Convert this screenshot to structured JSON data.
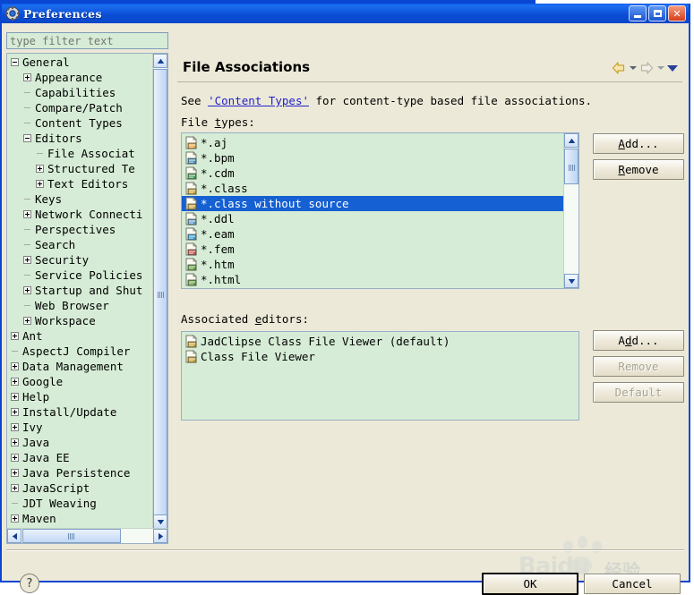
{
  "window": {
    "title": "Preferences",
    "icon": "preferences-gear-icon",
    "minimize_label": "Minimize",
    "maximize_label": "Maximize",
    "close_label": "Close",
    "title_bar_color": "#0a4fd6"
  },
  "sidebar": {
    "filter": {
      "placeholder": "type filter text",
      "value": ""
    },
    "items": [
      {
        "label": "General",
        "indent": 0,
        "toggle": "minus"
      },
      {
        "label": "Appearance",
        "indent": 1,
        "toggle": "plus"
      },
      {
        "label": "Capabilities",
        "indent": 1,
        "toggle": "dash"
      },
      {
        "label": "Compare/Patch",
        "indent": 1,
        "toggle": "dash"
      },
      {
        "label": "Content Types",
        "indent": 1,
        "toggle": "dash"
      },
      {
        "label": "Editors",
        "indent": 1,
        "toggle": "minus"
      },
      {
        "label": "File Associat",
        "indent": 2,
        "toggle": "dash",
        "selected_page": true
      },
      {
        "label": "Structured Te",
        "indent": 2,
        "toggle": "plus"
      },
      {
        "label": "Text Editors",
        "indent": 2,
        "toggle": "plus"
      },
      {
        "label": "Keys",
        "indent": 1,
        "toggle": "dash"
      },
      {
        "label": "Network Connecti",
        "indent": 1,
        "toggle": "plus"
      },
      {
        "label": "Perspectives",
        "indent": 1,
        "toggle": "dash"
      },
      {
        "label": "Search",
        "indent": 1,
        "toggle": "dash"
      },
      {
        "label": "Security",
        "indent": 1,
        "toggle": "plus"
      },
      {
        "label": "Service Policies",
        "indent": 1,
        "toggle": "dash"
      },
      {
        "label": "Startup and Shut",
        "indent": 1,
        "toggle": "plus"
      },
      {
        "label": "Web Browser",
        "indent": 1,
        "toggle": "dash"
      },
      {
        "label": "Workspace",
        "indent": 1,
        "toggle": "plus"
      },
      {
        "label": "Ant",
        "indent": 0,
        "toggle": "plus"
      },
      {
        "label": "AspectJ Compiler",
        "indent": 0,
        "toggle": "dash"
      },
      {
        "label": "Data Management",
        "indent": 0,
        "toggle": "plus"
      },
      {
        "label": "Google",
        "indent": 0,
        "toggle": "plus"
      },
      {
        "label": "Help",
        "indent": 0,
        "toggle": "plus"
      },
      {
        "label": "Install/Update",
        "indent": 0,
        "toggle": "plus"
      },
      {
        "label": "Ivy",
        "indent": 0,
        "toggle": "plus"
      },
      {
        "label": "Java",
        "indent": 0,
        "toggle": "plus"
      },
      {
        "label": "Java EE",
        "indent": 0,
        "toggle": "plus"
      },
      {
        "label": "Java Persistence",
        "indent": 0,
        "toggle": "plus"
      },
      {
        "label": "JavaScript",
        "indent": 0,
        "toggle": "plus"
      },
      {
        "label": "JDT Weaving",
        "indent": 0,
        "toggle": "dash"
      },
      {
        "label": "Maven",
        "indent": 0,
        "toggle": "plus"
      }
    ],
    "scroll": {
      "up_glyph": "▲",
      "down_glyph": "▼",
      "left_glyph": "◀",
      "right_glyph": "▶"
    }
  },
  "page": {
    "title": "File Associations",
    "description_prefix": "See ",
    "description_link": "'Content Types'",
    "description_suffix": " for content-type based file associations.",
    "filetypes_label_pre": "File ",
    "filetypes_label_mn": "t",
    "filetypes_label_post": "ypes:",
    "editors_label_pre": "Associated ",
    "editors_label_mn": "e",
    "editors_label_post": "ditors:",
    "nav": {
      "back": "back-navigation-arrow",
      "back_menu": "back-history-dropdown",
      "forward": "forward-navigation-arrow",
      "forward_menu": "forward-history-dropdown",
      "view_menu": "view-menu-chevron"
    }
  },
  "file_types": {
    "items": [
      {
        "label": "*.aj",
        "icon": "aspectj-file-icon",
        "icon_color": "#e8a33d",
        "selected": false
      },
      {
        "label": "*.bpm",
        "icon": "bpm-file-icon",
        "icon_color": "#3f8fbf",
        "selected": false
      },
      {
        "label": "*.cdm",
        "icon": "cdm-file-icon",
        "icon_color": "#3e9e57",
        "selected": false
      },
      {
        "label": "*.class",
        "icon": "class-file-icon",
        "icon_color": "#c8a030",
        "selected": false
      },
      {
        "label": "*.class without source",
        "icon": "class-file-icon",
        "icon_color": "#c8a030",
        "selected": true
      },
      {
        "label": "*.ddl",
        "icon": "ddl-file-icon",
        "icon_color": "#5a9ac8",
        "selected": false
      },
      {
        "label": "*.eam",
        "icon": "eam-file-icon",
        "icon_color": "#2f9ad0",
        "selected": false
      },
      {
        "label": "*.fem",
        "icon": "fem-file-icon",
        "icon_color": "#c0504d",
        "selected": false
      },
      {
        "label": "*.htm",
        "icon": "html-file-icon",
        "icon_color": "#5f9e3f",
        "selected": false
      },
      {
        "label": "*.html",
        "icon": "html-file-icon",
        "icon_color": "#5f9e3f",
        "selected": false
      }
    ],
    "selection_color": "#1560d2",
    "add_button": {
      "pre": "",
      "mn": "A",
      "post": "dd...",
      "enabled": true
    },
    "remove_button": {
      "pre": "",
      "mn": "R",
      "post": "emove",
      "enabled": true
    }
  },
  "associated_editors": {
    "items": [
      {
        "label": "JadClipse Class File Viewer (default)",
        "icon": "class-file-viewer-icon",
        "default": true
      },
      {
        "label": "Class File Viewer",
        "icon": "class-file-viewer-icon",
        "default": false
      }
    ],
    "add_button": {
      "pre": "A",
      "mn": "d",
      "post": "d...",
      "enabled": true
    },
    "remove_button": {
      "pre": "",
      "mn": "R",
      "post": "emove",
      "enabled": false
    },
    "default_button": {
      "pre": "",
      "mn": "D",
      "post": "efault",
      "enabled": false
    }
  },
  "footer": {
    "help_icon": "help-question-icon",
    "ok_label": "OK",
    "cancel_label": "Cancel"
  },
  "watermark": {
    "brand": "Baidu",
    "suffix": "经验"
  }
}
